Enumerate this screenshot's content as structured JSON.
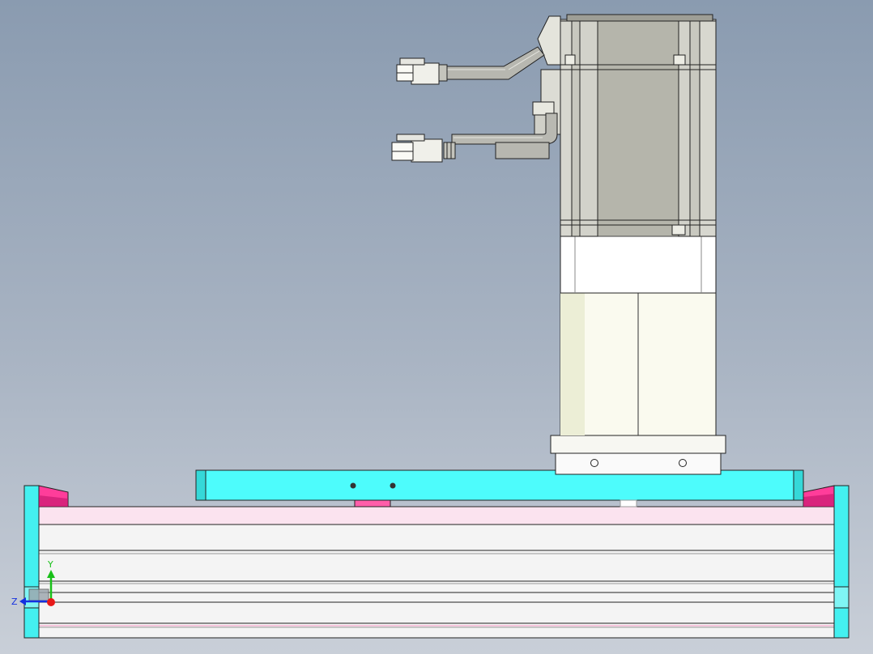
{
  "viewport": {
    "background_top": "#8a9bb0",
    "background_bottom": "#c9cfd8"
  },
  "colors": {
    "motor_body": "#b9b9b0",
    "motor_rib": "#d7d7cf",
    "gearbox": "#f7f7f0",
    "base_plate": "#4dfcfc",
    "rail_body": "#f3f3f3",
    "end_cap": "#44f0f0",
    "accent_magenta": "#ff3d9a"
  },
  "triad": {
    "y_label": "Y",
    "z_label": "Z",
    "y_color": "#18c018",
    "z_color": "#1430e0",
    "x_color": "#e81818"
  }
}
